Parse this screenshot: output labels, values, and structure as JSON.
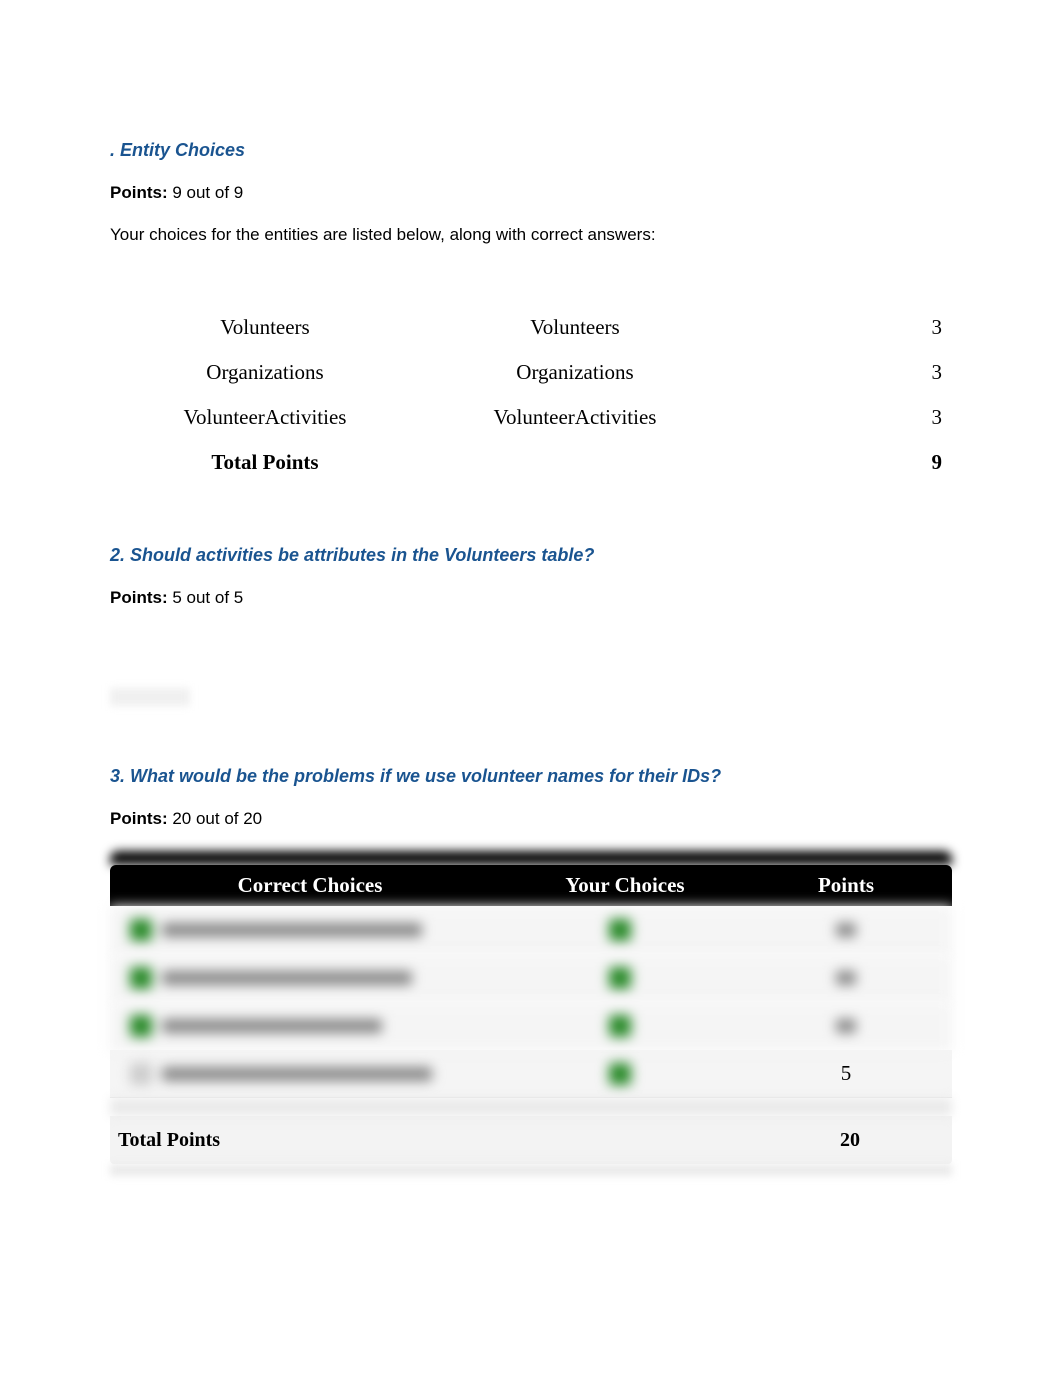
{
  "section1": {
    "heading": ". Entity Choices",
    "points_label": "Points:",
    "points_value": "9 out of 9",
    "description": "Your choices for the entities are listed below, along with correct answers:",
    "rows": [
      {
        "yours": "Volunteers",
        "correct": "Volunteers",
        "points": "3"
      },
      {
        "yours": "Organizations",
        "correct": "Organizations",
        "points": "3"
      },
      {
        "yours": "VolunteerActivities",
        "correct": "VolunteerActivities",
        "points": "3"
      }
    ],
    "total_label": "Total Points",
    "total_value": "9"
  },
  "section2": {
    "heading": "2. Should activities be attributes in the Volunteers table?",
    "points_label": "Points:",
    "points_value": "5 out of 5"
  },
  "section3": {
    "heading": "3. What would be the problems if we use volunteer names for their IDs?",
    "points_label": "Points:",
    "points_value": "20 out of 20",
    "table": {
      "headers": {
        "col1": "Correct Choices",
        "col2": "Your Choices",
        "col3": "Points"
      },
      "visible_row_points": "5",
      "total_label": "Total Points",
      "total_value": "20"
    }
  }
}
